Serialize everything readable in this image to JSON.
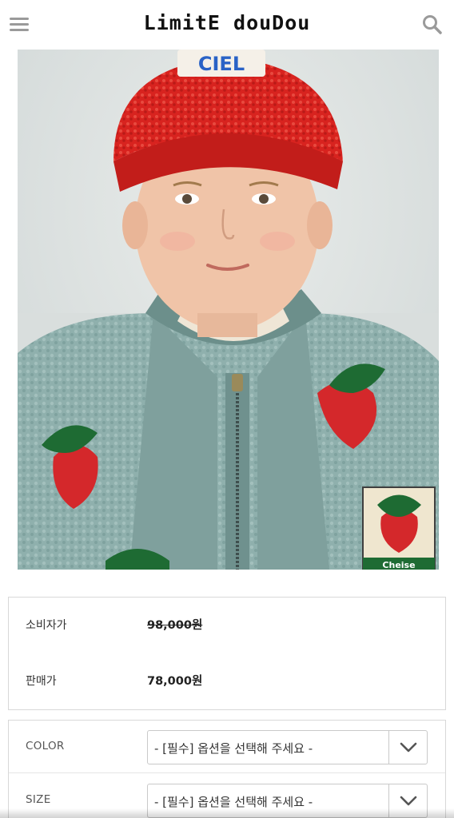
{
  "header": {
    "logo_text": "LimitE douDou",
    "menu_icon": "hamburger-menu-icon",
    "search_icon": "search-icon"
  },
  "product_image": {
    "badge_text": "CIEL",
    "patch_text": "Cheise"
  },
  "price": {
    "consumer_label": "소비자가",
    "consumer_value": "98,000원",
    "sale_label": "판매가",
    "sale_value": "78,000원"
  },
  "options": {
    "color_label": "COLOR",
    "color_value": "- [필수] 옵션을 선택해 주세요 -",
    "size_label": "SIZE",
    "size_value": "- [필수] 옵션을 선택해 주세요 -",
    "arrow_icon": "chevron-down-icon"
  },
  "colors": {
    "cap": "#d8231f",
    "jacket": "#8fb0ad",
    "strawberry": "#d4282b",
    "leaf": "#1e6b33"
  }
}
